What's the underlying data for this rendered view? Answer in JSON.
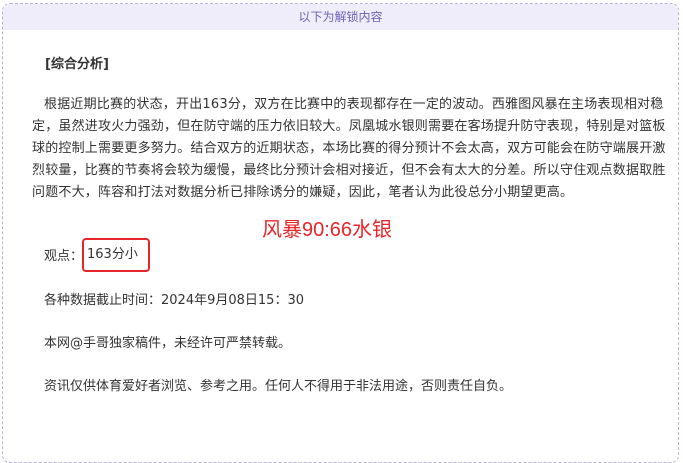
{
  "header": {
    "text": "以下为解锁内容"
  },
  "analysis": {
    "title": "[综合分析]",
    "paragraph": "根据近期比赛的状态，开出163分，双方在比赛中的表现都存在一定的波动。西雅图风暴在主场表现相对稳定，虽然进攻火力强劲，但在防守端的压力依旧较大。凤凰城水银则需要在客场提升防守表现，特别是对篮板球的控制上需要更多努力。结合双方的近期状态，本场比赛的得分预计不会太高，双方可能会在防守端展开激烈较量，比赛的节奏将会较为缓慢，最终比分预计会相对接近，但不会有太大的分差。所以守住观点数据取胜问题不大，阵容和打法对数据分析已排除诱分的嫌疑，因此，笔者认为此役总分小期望更高。"
  },
  "overlay": {
    "score_text": "风暴90:66水银"
  },
  "viewpoint": {
    "label": "观点：",
    "value": "163分小"
  },
  "cutoff": {
    "text": "各种数据截止时间：2024年9月08日15：30"
  },
  "copyright": {
    "text": "本网@手哥独家稿件，未经许可严禁转载。"
  },
  "disclaimer": {
    "text": "资讯仅供体育爱好者浏览、参考之用。任何人不得用于非法用途，否则责任自负。"
  },
  "colors": {
    "accent_red": "#e8262a",
    "header_bg": "#efedfa",
    "header_text": "#6d63b3",
    "border": "#b9aee6"
  }
}
